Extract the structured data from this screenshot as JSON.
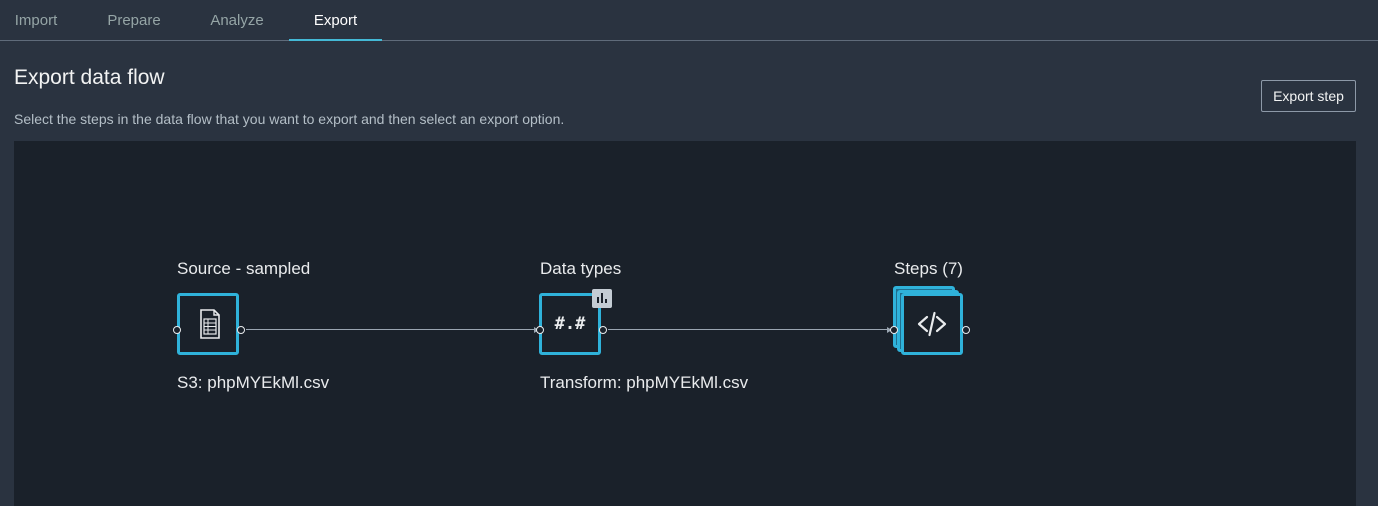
{
  "tabs": [
    {
      "label": "Import",
      "active": false
    },
    {
      "label": "Prepare",
      "active": false
    },
    {
      "label": "Analyze",
      "active": false
    },
    {
      "label": "Export",
      "active": true
    }
  ],
  "page": {
    "title": "Export data flow",
    "subtitle": "Select the steps in the data flow that you want to export and then select an export option.",
    "export_step_label": "Export step"
  },
  "flow": {
    "nodes": [
      {
        "title": "Source - sampled",
        "caption": "S3: phpMYEkMl.csv",
        "icon": "csv-file-icon"
      },
      {
        "title": "Data types",
        "caption": "Transform: phpMYEkMl.csv",
        "icon": "data-types-icon",
        "glyph": "#.#",
        "badge_icon": "bar-chart-icon"
      },
      {
        "title": "Steps (7)",
        "caption": "",
        "icon": "code-icon"
      }
    ]
  },
  "colors": {
    "background": "#2a3340",
    "canvas": "#1a212a",
    "accent": "#2fb2da",
    "active_tab_underline": "#44b9d6"
  }
}
